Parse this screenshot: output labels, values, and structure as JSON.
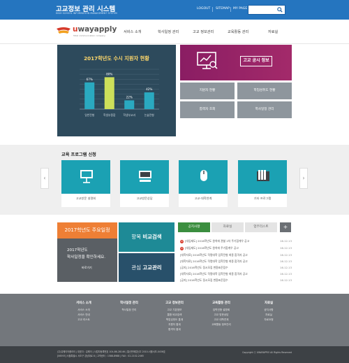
{
  "header": {
    "title": "고교정보 관리 시스템",
    "subtitle": "HIGH SCHOOL INFORMATION MANAGEMENT SYSTEM",
    "links": [
      "LOGOUT",
      "SITEMAP",
      "MY PAGE"
    ],
    "search_placeholder": ""
  },
  "brand": {
    "name_red": "u",
    "name_rest": "wayapply",
    "tagline": "Total communication company"
  },
  "nav": [
    "서비스 소개",
    "학사일정 관리",
    "고교 정보관리",
    "교육활동 관리",
    "자료실"
  ],
  "chart_data": {
    "type": "bar",
    "title": "2017학년도 수시 지원자 현황",
    "categories": [
      "일반전형",
      "학생부종합",
      "학생부교과",
      "논술전형"
    ],
    "values": [
      67,
      80,
      22,
      42
    ],
    "value_labels": [
      "67%",
      "80%",
      "22%",
      "42%"
    ],
    "ylim": [
      0,
      100
    ],
    "grid": true,
    "colors": [
      "#2aa9c0",
      "#cddf5a",
      "#2aa9c0",
      "#2aa9c0"
    ]
  },
  "gov_info": {
    "label": "고교 공시 정보",
    "tiles": [
      "지원자 현황",
      "학업성취도 현황",
      "합격자 조회",
      "학사일정 관리"
    ]
  },
  "education": {
    "title": "교육 프로그램 신청",
    "cards": [
      "고교방문 설명회",
      "고교방문상담",
      "고교-대학연계",
      "기타 프로그램"
    ],
    "prev": "‹",
    "next": "›"
  },
  "schedule": {
    "title": "2017학년도 주요일정",
    "line1": "2017학년도",
    "line2": "학사일정을 확인하세요.",
    "more": "바로가기"
  },
  "compare": {
    "prefix": "항목 ",
    "bold": "비교검색"
  },
  "interest": {
    "prefix": "관심 ",
    "bold": "고교관리"
  },
  "tabs": [
    "공지사항",
    "자료실",
    "업무리스트",
    "+"
  ],
  "news": [
    {
      "text": "[대입제도] 2016학년도 원칙에 관할 2차 주기합계우 공고",
      "date": "16.12.13",
      "new": true
    },
    {
      "text": "[대입제도] 2016학년도 원칙에 주기합계우 공고",
      "date": "16.12.13",
      "new": true
    },
    {
      "text": "[대학자료] 2016학년도 작명대학 입학전형 최종 합격자 공고",
      "date": "16.12.13",
      "new": false
    },
    {
      "text": "[대학자료] 2016학년도 작명대학 입학전형 최종 합격자 공고",
      "date": "16.12.13",
      "new": false
    },
    {
      "text": "[공지] 2016학년도 정시모집 변환표준점수",
      "date": "16.12.13",
      "new": false
    },
    {
      "text": "[대학자료] 2016학년도 작명대학 입학전형 최종 합격자 공고",
      "date": "16.12.13",
      "new": false
    },
    {
      "text": "[공지] 2016학년도 정시모집 변환표준점수",
      "date": "16.12.13",
      "new": false
    }
  ],
  "footer": {
    "cols": [
      {
        "head": "서비스 소개",
        "items": [
          "서비스 소개",
          "서비스 안내",
          "고교 리스트"
        ]
      },
      {
        "head": "학사일정 관리",
        "items": [
          "학사일정 관리"
        ]
      },
      {
        "head": "고교 정보관리",
        "items": [
          "고교 기본정보",
          "통합 비교검색",
          "학업성취도 통계",
          "지원자 통계",
          "합격자 통계"
        ]
      },
      {
        "head": "교육활동 관리",
        "items": [
          "입학전형 설명회",
          "고교 방문상담",
          "고교 대학연계",
          "교육활동 정보관리"
        ]
      },
      {
        "head": "자료실",
        "items": [
          "공지사항",
          "자료실",
          "자료요청"
        ]
      }
    ],
    "addr1": "(주)유웨이어플라이 | 대표자 : 유웨이 | 사업자등록번호 104-86-28146 | 통신판매업신고 2010-서울서초-0436호",
    "addr2": "[06593] 서울특별시 서초구 강남대로 8 | 고객센터 : 1588-8988 | FAX : 02-2102-2465",
    "copyright": "Copyright ⓒ UWAYAPPLY All Rights Reserved"
  }
}
